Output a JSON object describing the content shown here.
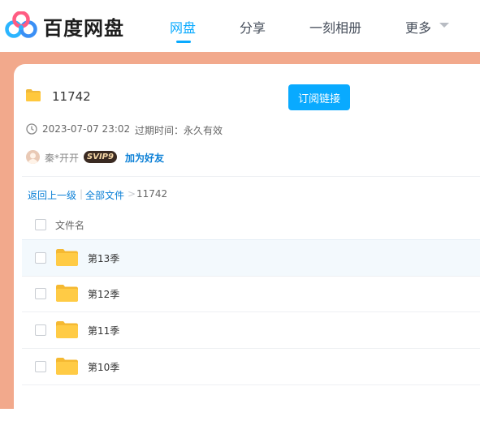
{
  "brand": {
    "name": "百度网盘"
  },
  "nav": {
    "items": [
      {
        "label": "网盘",
        "active": true
      },
      {
        "label": "分享",
        "active": false
      },
      {
        "label": "一刻相册",
        "active": false
      },
      {
        "label": "更多",
        "active": false
      }
    ]
  },
  "share": {
    "title": "11742",
    "subscribe_label": "订阅链接",
    "date": "2023-07-07 23:02",
    "expire": "过期时间：永久有效",
    "username": "秦*开开",
    "badge": "SVIP9",
    "add_friend": "加为好友"
  },
  "breadcrumb": {
    "back": "返回上一级",
    "separator": "|",
    "all_files": "全部文件",
    "arrow": ">",
    "current": "11742"
  },
  "list": {
    "column_name": "文件名",
    "rows": [
      {
        "name": "第13季"
      },
      {
        "name": "第12季"
      },
      {
        "name": "第11季"
      },
      {
        "name": "第10季"
      }
    ]
  },
  "colors": {
    "accent": "#09aaff",
    "page_background": "#f2a98c",
    "link": "#0a7fd6",
    "folder": "#ffc83d"
  }
}
